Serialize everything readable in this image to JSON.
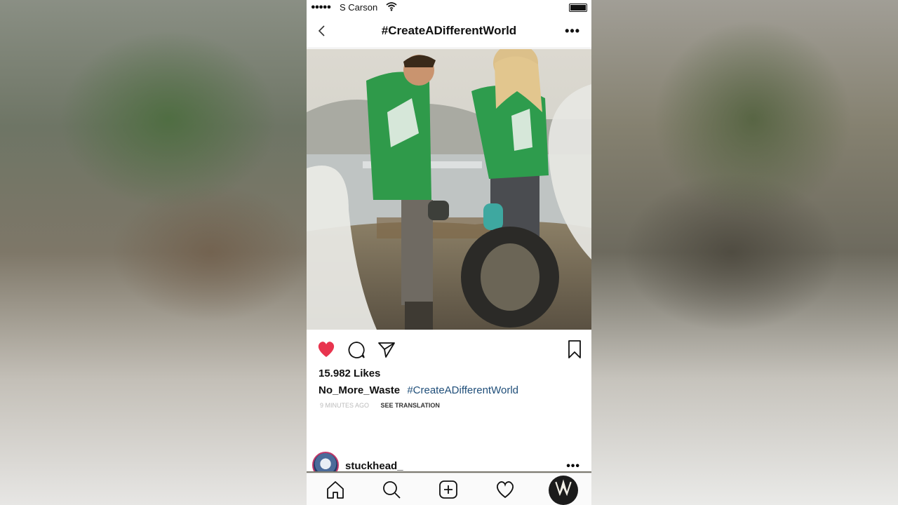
{
  "status_bar": {
    "signal_dots": "●●●●●",
    "carrier": "S Carson"
  },
  "navbar": {
    "title": "#CreateADifferentWorld"
  },
  "post": {
    "likes": "15.982 Likes",
    "username": "No_More_Waste",
    "hashtag": "#CreateADifferentWorld",
    "time": "9 MINUTES AGO",
    "translate": "SEE TRANSLATION",
    "liked": true
  },
  "next_post": {
    "username": "stuckhead_"
  },
  "colors": {
    "heart": "#e8344e",
    "hashtag": "#1f4e79"
  },
  "icons": {
    "back": "chevron-left-icon",
    "more": "ellipsis-icon",
    "like": "heart-icon",
    "comment": "comment-icon",
    "share": "paper-plane-icon",
    "save": "bookmark-icon",
    "tabs": [
      "home-icon",
      "search-icon",
      "add-icon",
      "heart-outline-icon",
      "profile-avatar"
    ]
  }
}
